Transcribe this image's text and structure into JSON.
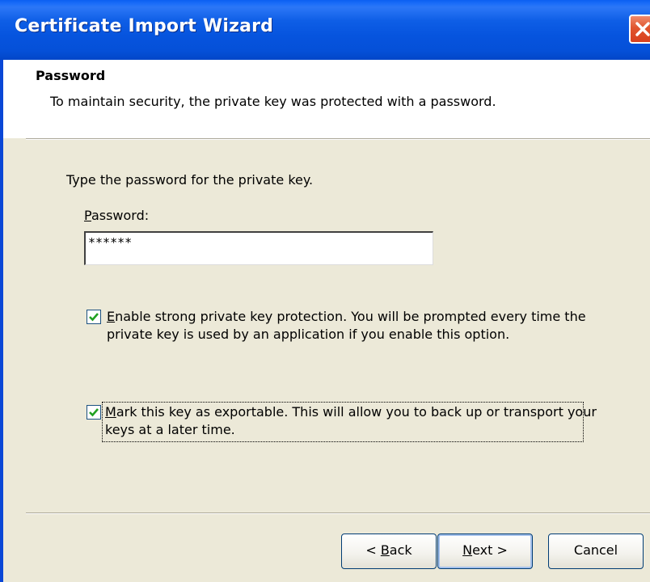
{
  "window": {
    "title": "Certificate Import Wizard"
  },
  "header": {
    "title": "Password",
    "subtitle": "To maintain security, the private key was protected with a password."
  },
  "body": {
    "prompt": "Type the password for the private key.",
    "password_label_mnemonic": "P",
    "password_label_rest": "assword:",
    "password_value": "******",
    "checkbox1": {
      "checked": true,
      "mnemonic": "E",
      "line1_rest": "nable strong private key protection. You will be prompted every time the",
      "line2": "private key is used by an application if you enable this option."
    },
    "checkbox2": {
      "checked": true,
      "mnemonic": "M",
      "line1_rest": "ark this key as exportable. This will allow you to back up or transport your",
      "line2": "keys at a later time."
    }
  },
  "buttons": {
    "back_prefix": "< ",
    "back_mnemonic": "B",
    "back_rest": "ack",
    "next_mnemonic": "N",
    "next_rest": "ext >",
    "cancel": "Cancel"
  },
  "colors": {
    "titlebar": "#0654de",
    "close": "#d8401e",
    "dialog_bg": "#ece9d8",
    "checkmark": "#21a121"
  },
  "icons": {
    "close": "close-icon",
    "check": "checkmark-icon"
  }
}
